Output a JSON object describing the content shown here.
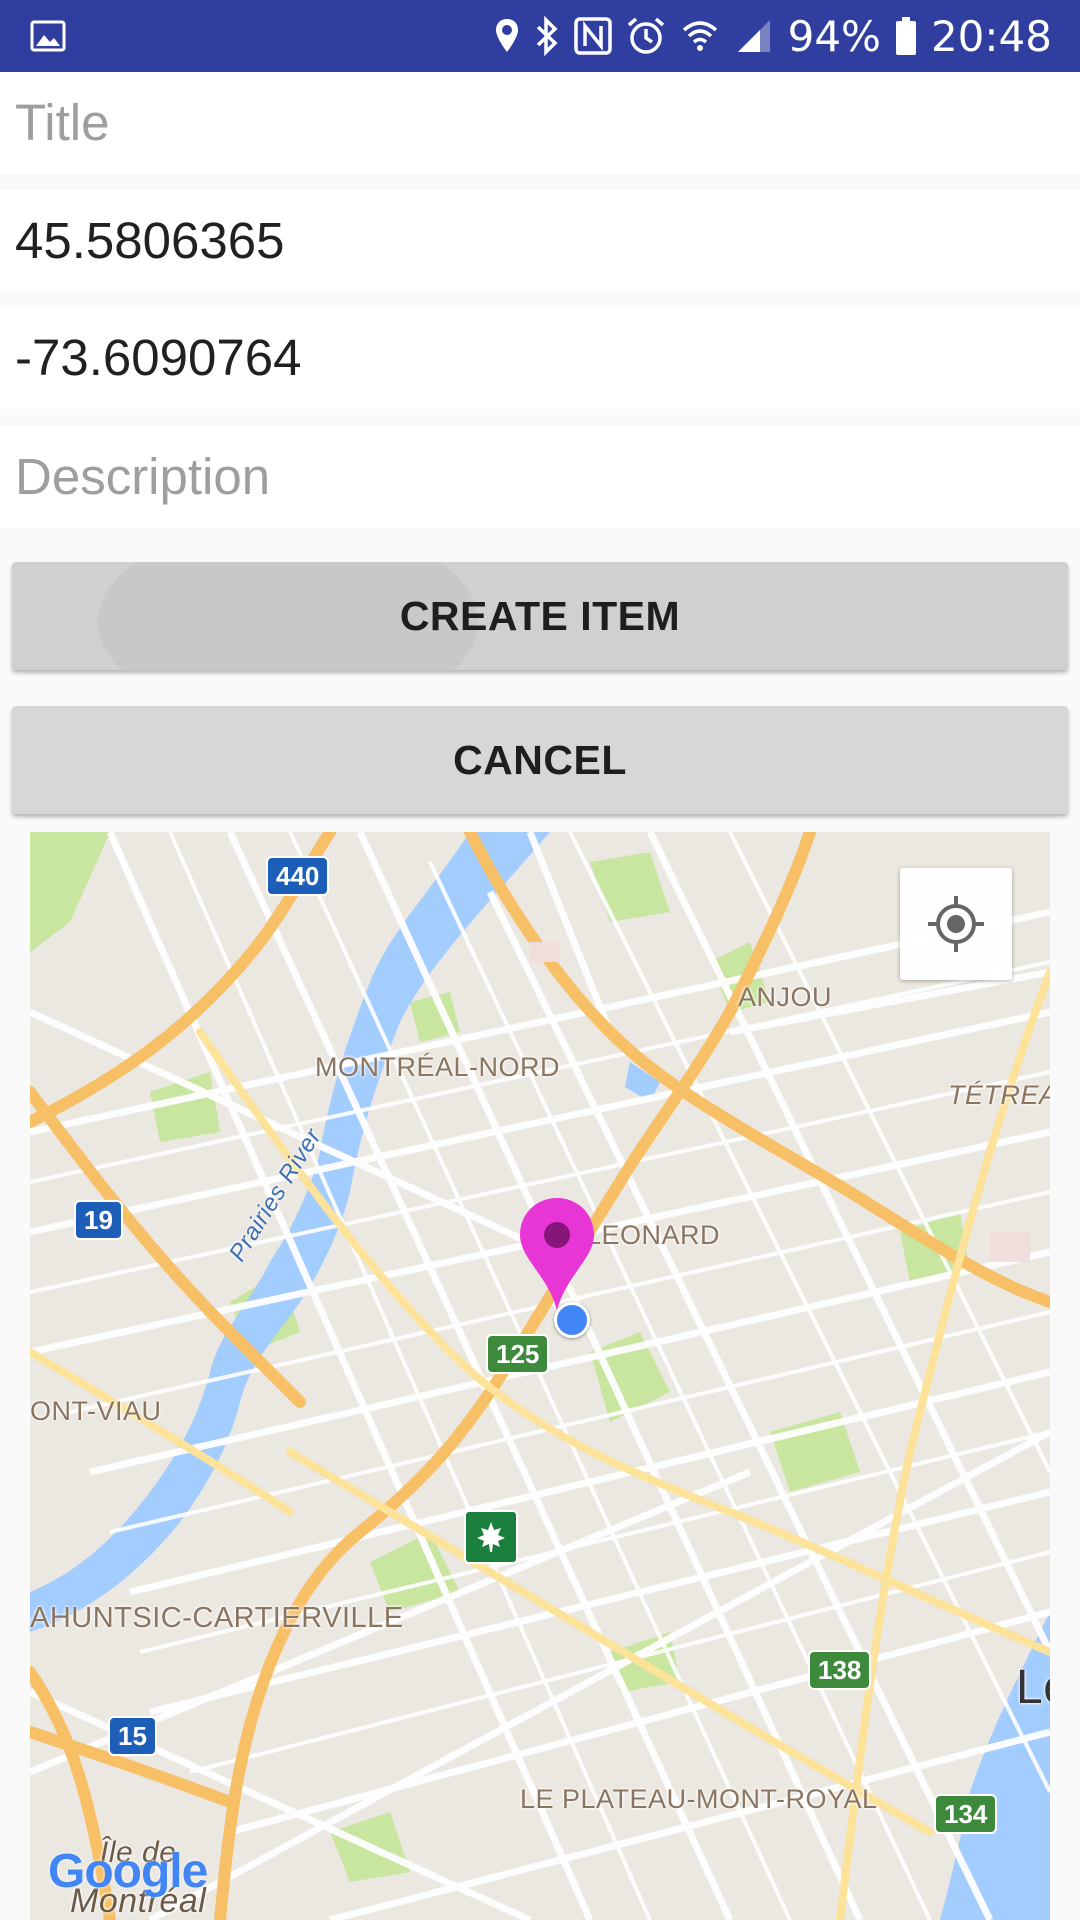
{
  "status_bar": {
    "battery_percent": "94%",
    "time": "20:48",
    "icons": [
      "gallery-icon",
      "location-icon",
      "bluetooth-icon",
      "nfc-icon",
      "alarm-icon",
      "wifi-icon",
      "signal-icon",
      "battery-icon"
    ]
  },
  "form": {
    "title_placeholder": "Title",
    "latitude_value": "45.5806365",
    "longitude_value": "-73.6090764",
    "description_placeholder": "Description"
  },
  "buttons": {
    "create_label": "CREATE ITEM",
    "cancel_label": "CANCEL"
  },
  "map": {
    "labels": {
      "anjou": "ANJOU",
      "montreal_nord": "MONTRÉAL-NORD",
      "tetreau": "TÉTREAU",
      "leonard": "LEONARD",
      "prairies_river": "Prairies River",
      "ont_viau": "ONT-VIAU",
      "ahuntsic": "AHUNTSIC-CARTIERVILLE",
      "plateau": "LE PLATEAU-MONT-ROYAL",
      "ile_de": "Île de",
      "montreal": "Montréal",
      "le": "Le"
    },
    "shields": {
      "r440": "440",
      "r19": "19",
      "r125": "125",
      "r138": "138",
      "r15": "15",
      "r134": "134"
    },
    "attribution": "Google",
    "colors": {
      "land": "#ebe7e1",
      "water": "#a3ccff",
      "park": "#c8e6a0",
      "highway": "#f7c067",
      "marker": "#e835d6"
    }
  }
}
